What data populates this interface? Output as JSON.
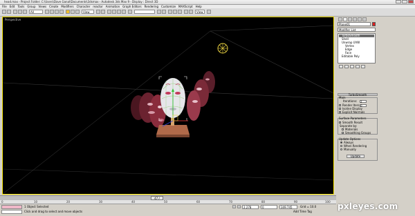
{
  "window": {
    "title": "head.max  -  Project Folder: C:\\Users\\Dave Ganal\\Documents\\3dsmax  -  Autodesk 3ds Max 9  -  Display : Direct 3D"
  },
  "menu": [
    "File",
    "Edit",
    "Tools",
    "Group",
    "Views",
    "Create",
    "Modifiers",
    "Character",
    "reactor",
    "Animation",
    "Graph Editors",
    "Rendering",
    "Customize",
    "MAXScript",
    "Help"
  ],
  "toolbar": {
    "selection_filter": "All",
    "reference_coord": "View",
    "named_selection": "",
    "view_dropdown": "View"
  },
  "viewport": {
    "label": "Perspective"
  },
  "command_panel": {
    "object_name": "Plane01",
    "modifier_list": "Modifier List",
    "stack": [
      "TurboSmooth",
      "Shell",
      "Unwrap UVW",
      "Vertex",
      "Edge",
      "Face",
      "Editable Poly"
    ],
    "turbosmooth": {
      "header": "TurboSmooth",
      "main_label": "Main",
      "iterations_label": "Iterations:",
      "iterations_value": "2",
      "render_iters_label": "Render Iters:",
      "render_iters_value": "0",
      "isoline_display": "Isoline Display",
      "explicit_normals": "Explicit Normals",
      "surface_params": "Surface Parameters",
      "smooth_result": "Smooth Result",
      "separate_by": "Separate by:",
      "materials": "Materials",
      "smoothing_groups": "Smoothing Groups",
      "update_options": "Update Options",
      "always": "Always",
      "when_rendering": "When Rendering",
      "manually": "Manually",
      "update_button": "Update"
    }
  },
  "timeline": {
    "slider_label": "47 / 100",
    "ticks": [
      "0",
      "10",
      "20",
      "30",
      "40",
      "50",
      "60",
      "70",
      "80",
      "90",
      "100"
    ]
  },
  "status": {
    "objects_selected": "1 Object Selected",
    "prompt": "Click and drag to select and move objects",
    "x_value": "2.278",
    "y_value": "0",
    "z_value": "349.745",
    "grid": "Grid = 10.0",
    "add_time_tag": "Add Time Tag",
    "auto_key": "Auto Key",
    "set_key": "Set Key",
    "selected": "Selected"
  },
  "watermark": "pxleyes.com",
  "colors": {
    "viewport_bg": "#000000",
    "active_border": "#f6e400",
    "panel_bg": "#d4d0c8"
  }
}
